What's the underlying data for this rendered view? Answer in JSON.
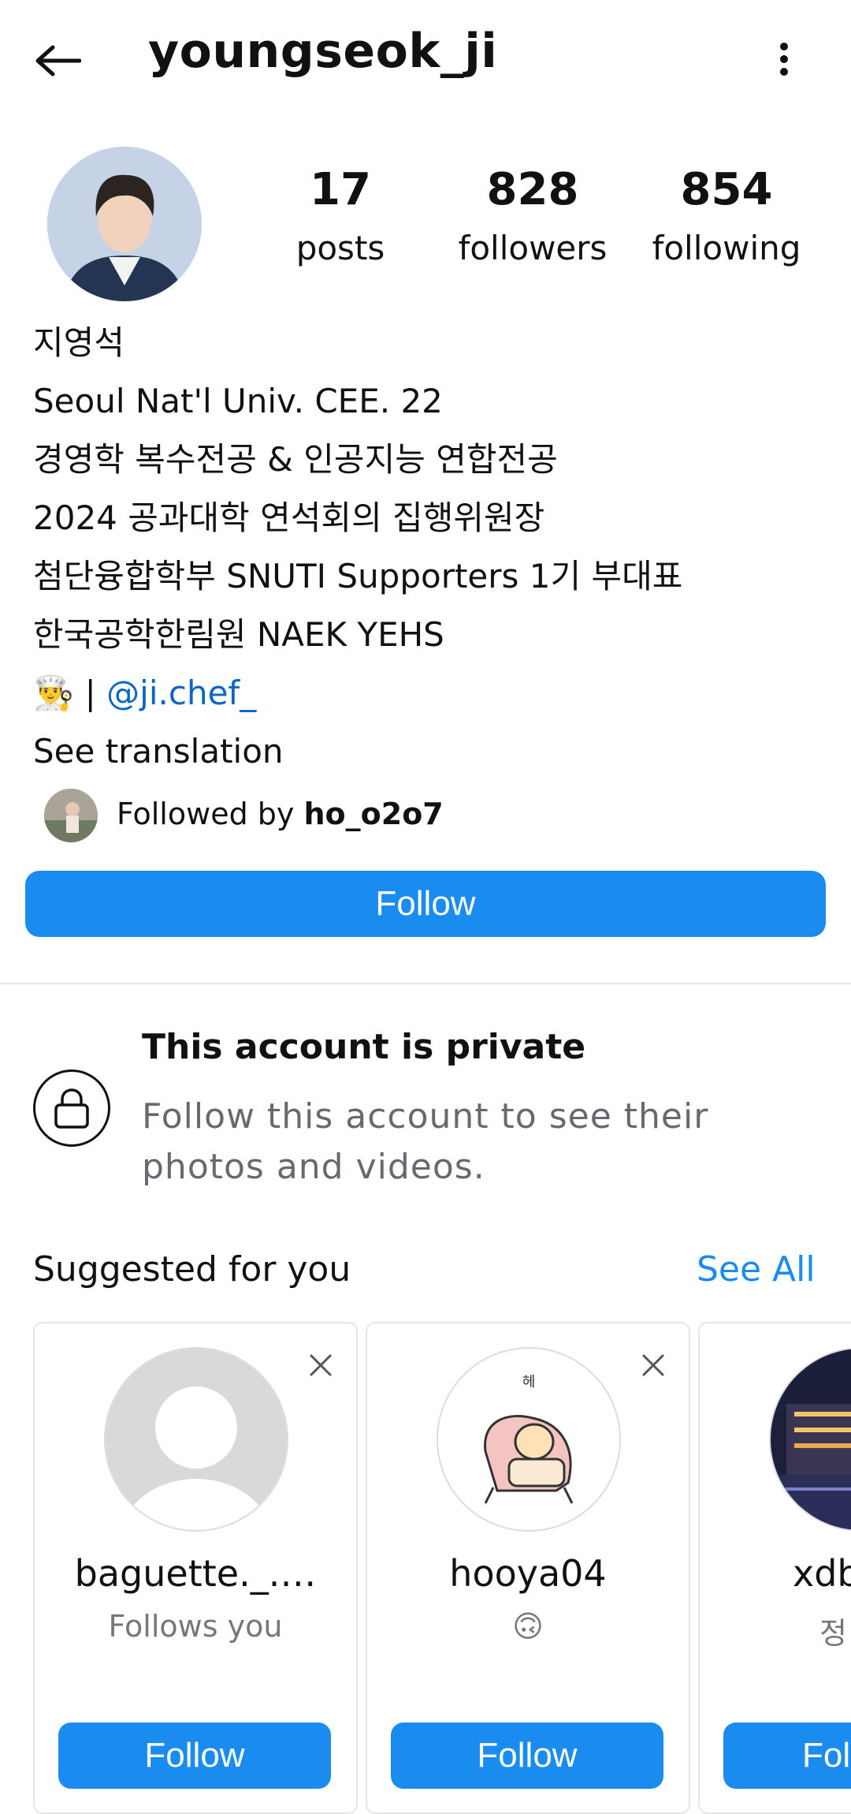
{
  "header": {
    "title": "youngseok_ji",
    "back_icon": "arrow-left-icon",
    "more_icon": "more-vertical-icon"
  },
  "stats": {
    "posts_count": "17",
    "posts_label": "posts",
    "followers_count": "828",
    "followers_label": "followers",
    "following_count": "854",
    "following_label": "following"
  },
  "bio": {
    "name": "지영석",
    "line1": "Seoul Nat'l Univ. CEE. 22",
    "line2": "경영학 복수전공 & 인공지능 연합전공",
    "line3": "2024 공과대학 연석회의 집행위원장",
    "line4": "첨단융합학부 SNUTI Supporters 1기 부대표",
    "line5": "한국공학한림원 NAEK YEHS",
    "emoji": "👨‍🍳",
    "separator": "|",
    "mention": "@ji.chef_",
    "see_translation": "See translation"
  },
  "followed_by": {
    "prefix": "Followed by",
    "username": "ho_o2o7"
  },
  "follow_button": "Follow",
  "private": {
    "title": "This account is private",
    "subtitle": "Follow this account to see their photos and videos."
  },
  "suggested": {
    "title": "Suggested for you",
    "see_all": "See All",
    "cards": [
      {
        "name": "baguette._.…",
        "subtitle": "Follows you",
        "button": "Follow"
      },
      {
        "name": "hooya04",
        "subtitle": "🙃",
        "avatar_text": "헤",
        "button": "Follow"
      },
      {
        "name": "xdb",
        "subtitle": "정",
        "button": "Fol"
      }
    ]
  },
  "colors": {
    "accent": "#1a8cf0",
    "mention": "#0b66c3",
    "muted": "#666a70"
  }
}
